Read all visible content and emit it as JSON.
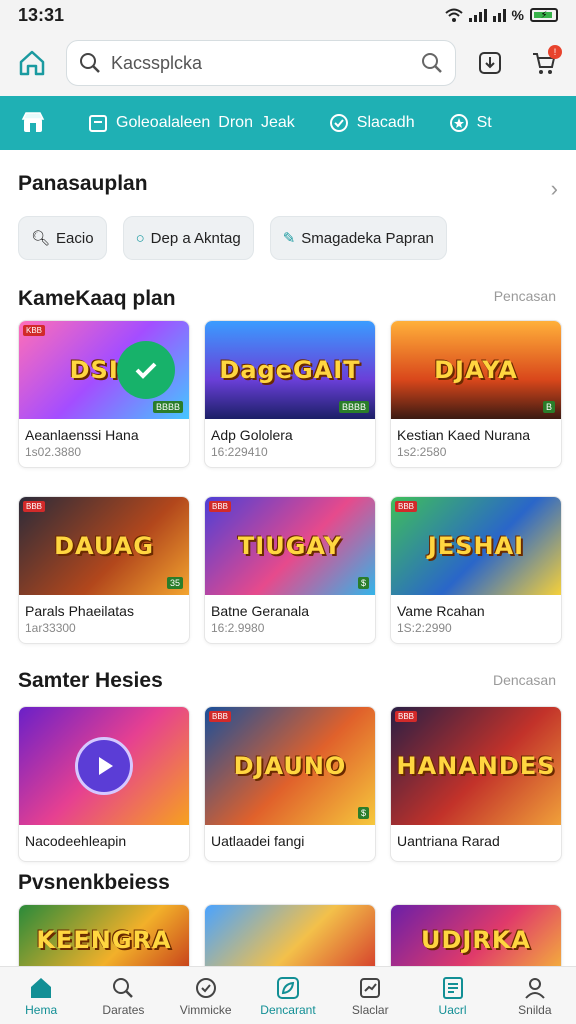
{
  "status": {
    "time": "13:31",
    "percent": "%"
  },
  "header": {
    "search_placeholder": "Kacssplcka"
  },
  "teal_nav": {
    "items": [
      {
        "label": "Goleoalaleen",
        "icon": "store-icon"
      },
      {
        "label": "Dron",
        "icon": "calendar-icon"
      },
      {
        "label": "Jeak",
        "icon": "check-circle-icon"
      },
      {
        "label": "Slacadh",
        "icon": "sparkle-icon"
      },
      {
        "label": "St",
        "icon": "star-icon"
      }
    ]
  },
  "section1": {
    "title": "Panasauplan",
    "chips": [
      {
        "label": "Eacio",
        "icon": "search-icon"
      },
      {
        "label": "Dep a Akntag",
        "icon": "ring-icon"
      },
      {
        "label": "Smagadeka Papran",
        "icon": "brush-icon"
      }
    ]
  },
  "section2": {
    "title": "KameKaaq plan",
    "more": "Pencasan",
    "cards": [
      {
        "title": "Aeanlaenssi Hana",
        "sub": "1s02.3880",
        "art": "DSIK",
        "tag": "KBB",
        "corner": "BBBB"
      },
      {
        "title": "Adp Gololera",
        "sub": "16:229410",
        "art": "DageGAIT",
        "tag": "",
        "corner": "BBBB"
      },
      {
        "title": "Kestian Kaed Nurana",
        "sub": "1s2:2580",
        "art": "DJAYA",
        "tag": "",
        "corner": "B"
      },
      {
        "title": "Parals Phaeilatas",
        "sub": "1ar33300",
        "art": "DAUAG",
        "tag": "BBB",
        "corner": "35"
      },
      {
        "title": "Batne Geranala",
        "sub": "16:2.9980",
        "art": "TIUGAY",
        "tag": "BBB",
        "corner": "$"
      },
      {
        "title": "Vame Rcahan",
        "sub": "1S:2:2990",
        "art": "JESHAI",
        "tag": "BBB",
        "corner": ""
      }
    ]
  },
  "section3": {
    "title": "Samter Hesies",
    "more": "Dencasan",
    "cards": [
      {
        "title": "Nacodeehleapin",
        "art": "",
        "tag": "",
        "corner": ""
      },
      {
        "title": "Uatlaadei fangi",
        "art": "DJAUNO",
        "tag": "BBB",
        "corner": "$"
      },
      {
        "title": "Uantriana Rarad",
        "art": "HANANDES",
        "tag": "BBB",
        "corner": ""
      }
    ]
  },
  "section4": {
    "title": "Pvsnenkbeiess",
    "cards": [
      {
        "art": "KEENGRA"
      },
      {
        "art": ""
      },
      {
        "art": "UDJRKA"
      }
    ]
  },
  "bottom_nav": [
    {
      "label": "Hema",
      "icon": "home-icon",
      "active": true
    },
    {
      "label": "Darates",
      "icon": "search-icon",
      "active": false
    },
    {
      "label": "Vimmicke",
      "icon": "check-circle-icon",
      "active": false
    },
    {
      "label": "Dencarant",
      "icon": "leaf-icon",
      "active": true
    },
    {
      "label": "Slaclar",
      "icon": "chart-icon",
      "active": false
    },
    {
      "label": "Uacrl",
      "icon": "list-icon",
      "active": true
    },
    {
      "label": "Snilda",
      "icon": "user-icon",
      "active": false
    }
  ],
  "colors": {
    "accent": "#1fb0b4",
    "active_nav": "#128f95",
    "notify": "#e8432d"
  }
}
